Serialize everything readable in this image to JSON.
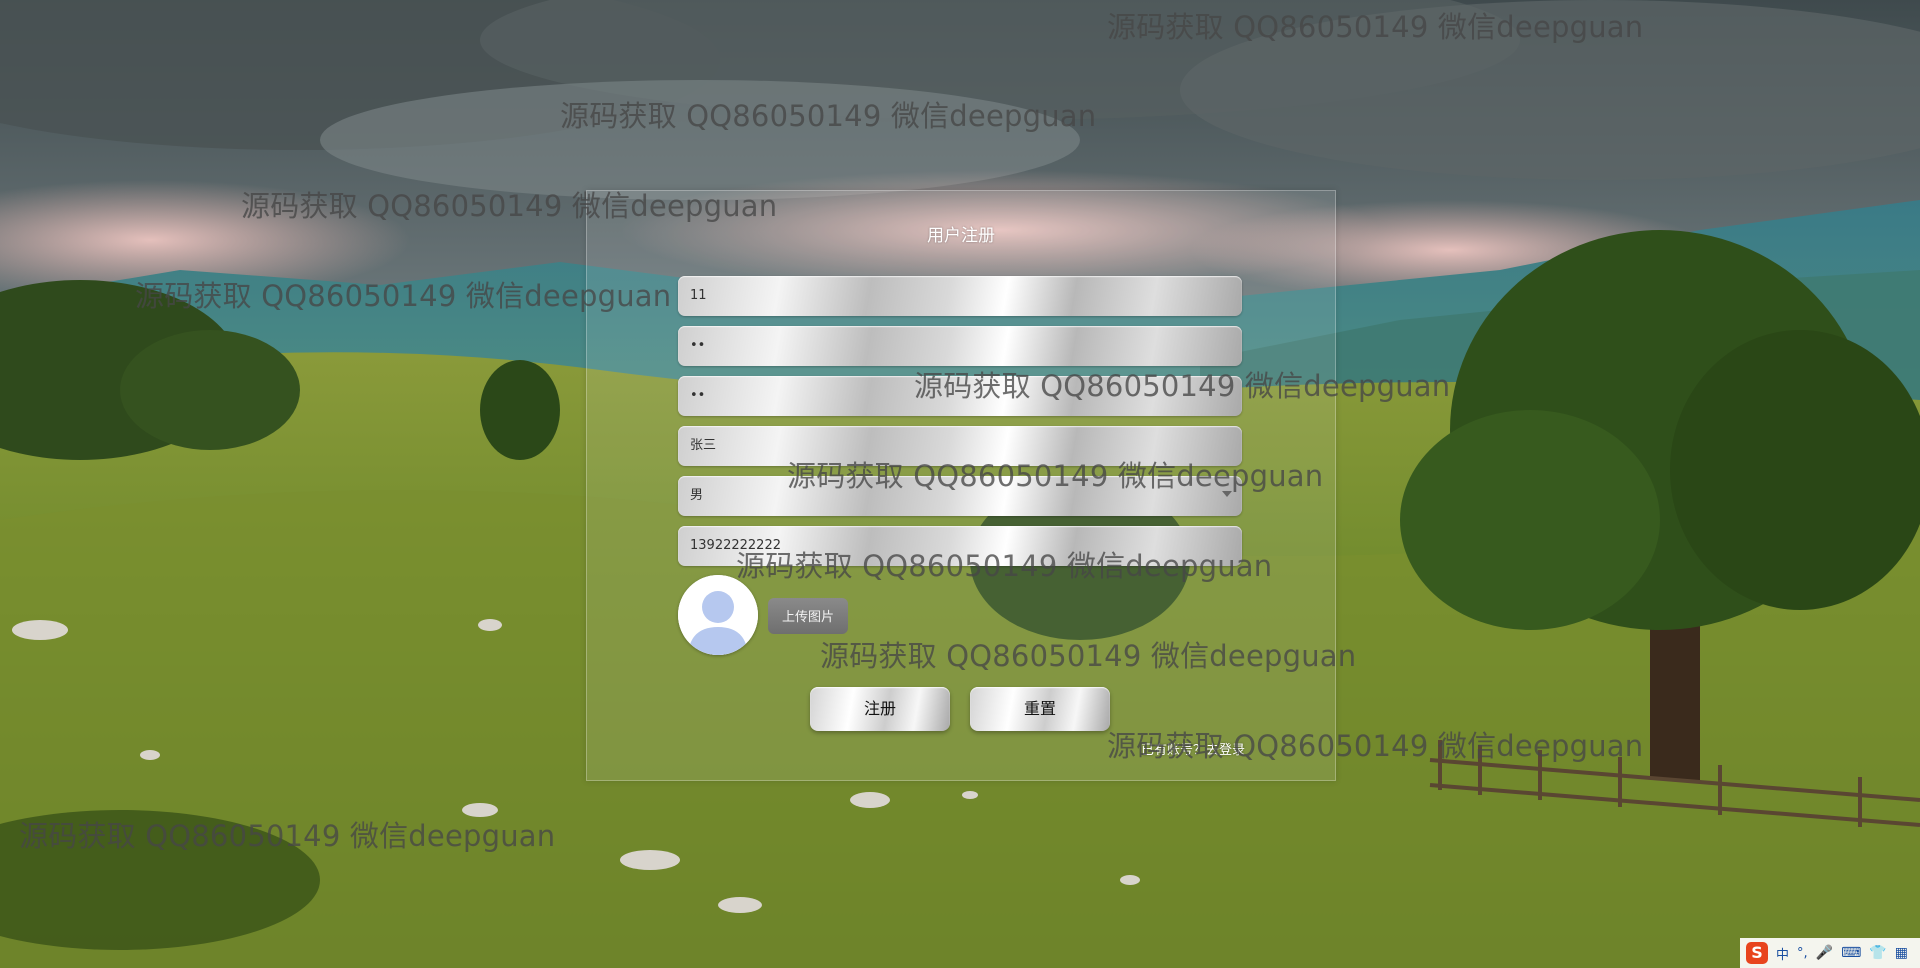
{
  "form": {
    "title": "用户注册",
    "account": "11",
    "password": "••",
    "confirm_password": "••",
    "name": "张三",
    "gender": "男",
    "phone": "13922222222",
    "upload_label": "上传图片",
    "register_label": "注册",
    "reset_label": "重置",
    "login_link": "已有账号？去登录"
  },
  "watermark_text": "源码获取 QQ86050149 微信deepguan",
  "ime": {
    "logo": "S",
    "mode": "中",
    "punct": "°,",
    "icons": [
      "microphone-icon",
      "keyboard-icon",
      "skin-icon",
      "toolbox-icon"
    ]
  },
  "colors": {
    "panel_bg": "rgba(255,255,255,0.10)",
    "title_text": "#ffffff",
    "button_text": "#111111",
    "ime_logo": "#e8441d"
  }
}
